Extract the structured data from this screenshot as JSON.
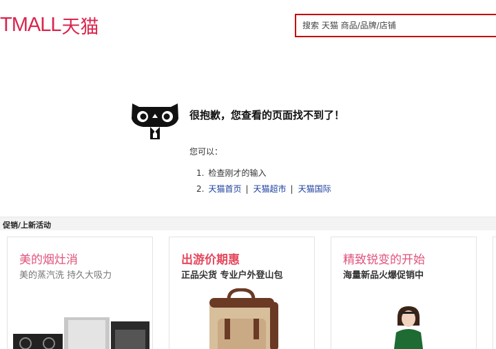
{
  "header": {
    "logo_latin": "TMALL",
    "logo_cjk": "天猫",
    "search_placeholder": "搜索 天猫 商品/品牌/店铺"
  },
  "error": {
    "title": "很抱歉，您查看的页面找不到了！",
    "subtitle": "您可以：",
    "items": [
      {
        "num": "1.",
        "text": "检查刚才的输入"
      },
      {
        "num": "2.",
        "links": [
          "天猫首页",
          "天猫超市",
          "天猫国际"
        ],
        "separator": "|"
      }
    ]
  },
  "promo": {
    "section_title": "促销/上新活动",
    "cards": [
      {
        "title": "美的烟灶消",
        "subtitle": "美的蒸汽洗  持久大吸力"
      },
      {
        "title": "出游价期惠",
        "subtitle": "正品尖货 专业户外登山包"
      },
      {
        "title": "精致锐变的开始",
        "subtitle": "海量新品火爆促销中"
      }
    ]
  },
  "colors": {
    "brand": "#d9264e",
    "search_border": "#c40000",
    "link": "#1a3e9c"
  }
}
